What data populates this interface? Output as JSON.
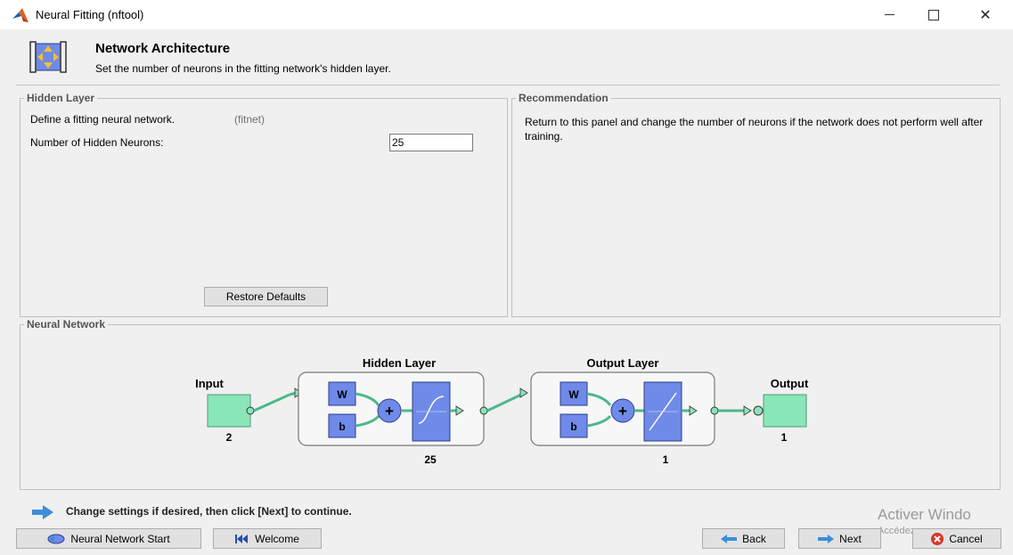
{
  "window": {
    "title": "Neural Fitting (nftool)",
    "minimize": "—",
    "maximize": "□",
    "close": "✕"
  },
  "header": {
    "title": "Network Architecture",
    "subtitle": "Set the number of neurons in the fitting network's hidden layer."
  },
  "hidden_panel": {
    "legend": "Hidden Layer",
    "define_text": "Define a fitting neural network.",
    "define_hint": "(fitnet)",
    "neurons_label": "Number of Hidden Neurons:",
    "neurons_value": "25",
    "restore_label": "Restore Defaults"
  },
  "recommendation_panel": {
    "legend": "Recommendation",
    "text": "Return to this panel and change the number of neurons if the network does not perform well after training."
  },
  "network_panel": {
    "legend": "Neural Network",
    "input_label": "Input",
    "input_count": "2",
    "hidden_title": "Hidden Layer",
    "hidden_count": "25",
    "output_layer_title": "Output Layer",
    "output_layer_count": "1",
    "output_label": "Output",
    "output_count": "1",
    "weight_label": "W",
    "bias_label": "b",
    "plus": "+"
  },
  "footer": {
    "instruction": "Change settings  if desired, then click [Next] to continue.",
    "buttons": {
      "start": "Neural Network Start",
      "welcome": "Welcome",
      "back": "Back",
      "next": "Next",
      "cancel": "Cancel"
    }
  },
  "watermark": {
    "line1": "Activer Windo",
    "line2": "Accédez aux param"
  },
  "colors": {
    "accent_blue": "#6f8ae8",
    "node_green": "#8ae6b8",
    "link_green": "#4db88a",
    "button_bg": "#e1e1e1"
  }
}
